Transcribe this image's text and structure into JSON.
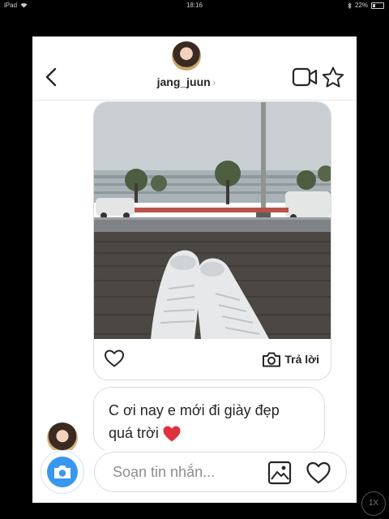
{
  "statusbar": {
    "device": "iPad",
    "time": "18:16",
    "battery": "22%"
  },
  "header": {
    "username": "jang_juun",
    "username_chevron": "›",
    "icons": [
      "back-arrow-icon",
      "video-call-icon",
      "star-icon"
    ]
  },
  "post": {
    "image_description": "white sneakers on brick pavement, street and trees in background",
    "reply_label": "Trả lời",
    "icons": [
      "heart-outline-icon",
      "camera-outline-icon"
    ]
  },
  "message": {
    "line1": "C ơi  nay e mới đi giày  đẹp",
    "line2": "quá trời",
    "emoji": "red-heart-emoji"
  },
  "composer": {
    "placeholder": "Soạn tin nhắn...",
    "icons": [
      "camera-icon",
      "gallery-icon",
      "heart-outline-icon"
    ]
  },
  "zoom": "1X",
  "colors": {
    "accent_blue": "#3897f0",
    "heart_red": "#e0323c",
    "text": "#262626",
    "placeholder": "#8e8e8e"
  }
}
